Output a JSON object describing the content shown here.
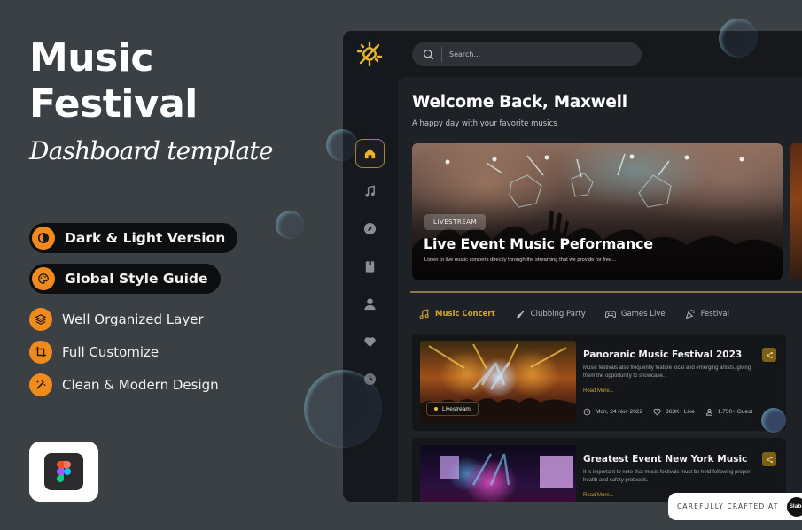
{
  "promo": {
    "title_line1": "Music",
    "title_line2": "Festival",
    "subtitle": "Dashboard template",
    "features": [
      {
        "icon": "contrast-icon",
        "label": "Dark & Light Version",
        "highlighted": true
      },
      {
        "icon": "palette-icon",
        "label": "Global Style Guide",
        "highlighted": true
      },
      {
        "icon": "layers-icon",
        "label": "Well Organized Layer",
        "highlighted": false
      },
      {
        "icon": "crop-icon",
        "label": "Full Customize",
        "highlighted": false
      },
      {
        "icon": "magic-wand-icon",
        "label": "Clean & Modern Design",
        "highlighted": false
      }
    ],
    "figma_badge": "figma-logo-icon"
  },
  "colors": {
    "accent": "#d6a72c",
    "feature_orange": "#f08a1c",
    "background": "#3b4044",
    "dashboard_bg": "#1e2125"
  },
  "dashboard": {
    "search": {
      "placeholder": "Search..."
    },
    "sidebar": [
      {
        "icon": "home-icon",
        "active": true
      },
      {
        "icon": "music-note-icon",
        "active": false
      },
      {
        "icon": "compass-icon",
        "active": false
      },
      {
        "icon": "book-icon",
        "active": false
      },
      {
        "icon": "user-icon",
        "active": false
      },
      {
        "icon": "heart-icon",
        "active": false
      },
      {
        "icon": "clock-icon",
        "active": false
      }
    ],
    "welcome_title": "Welcome Back, Maxwell",
    "welcome_sub": "A happy day with your favorite musics",
    "hero": {
      "badge": "LIVESTREAM",
      "title": "Live Event Music Peformance",
      "description": "Listen to live music concerts directly through the streaming that we provide for free..."
    },
    "tabs": [
      {
        "icon": "music-note-icon",
        "label": "Music Concert",
        "active": true
      },
      {
        "icon": "bottle-icon",
        "label": "Clubbing Party",
        "active": false
      },
      {
        "icon": "gamepad-icon",
        "label": "Games Live",
        "active": false
      },
      {
        "icon": "party-popper-icon",
        "label": "Festival",
        "active": false
      }
    ],
    "events": [
      {
        "badge": "Livestream",
        "title": "Panoranic Music Festival 2023",
        "description": "Music festivals also frequently feature local and emerging artists, giving them the opportunity to showcase...",
        "read_more": "Read More...",
        "date": "Mon, 24 Nov 2022",
        "likes": "363K+ Like",
        "guests": "1.750+ Guest"
      },
      {
        "title": "Greatest Event New York Music",
        "description": "It is important to note that music festivals must be held following proper health and safety protocols.",
        "read_more": "Read More..."
      }
    ]
  },
  "footer": {
    "crafted_label": "CAREFULLY CRAFTED AT",
    "brand": "Slab!"
  }
}
